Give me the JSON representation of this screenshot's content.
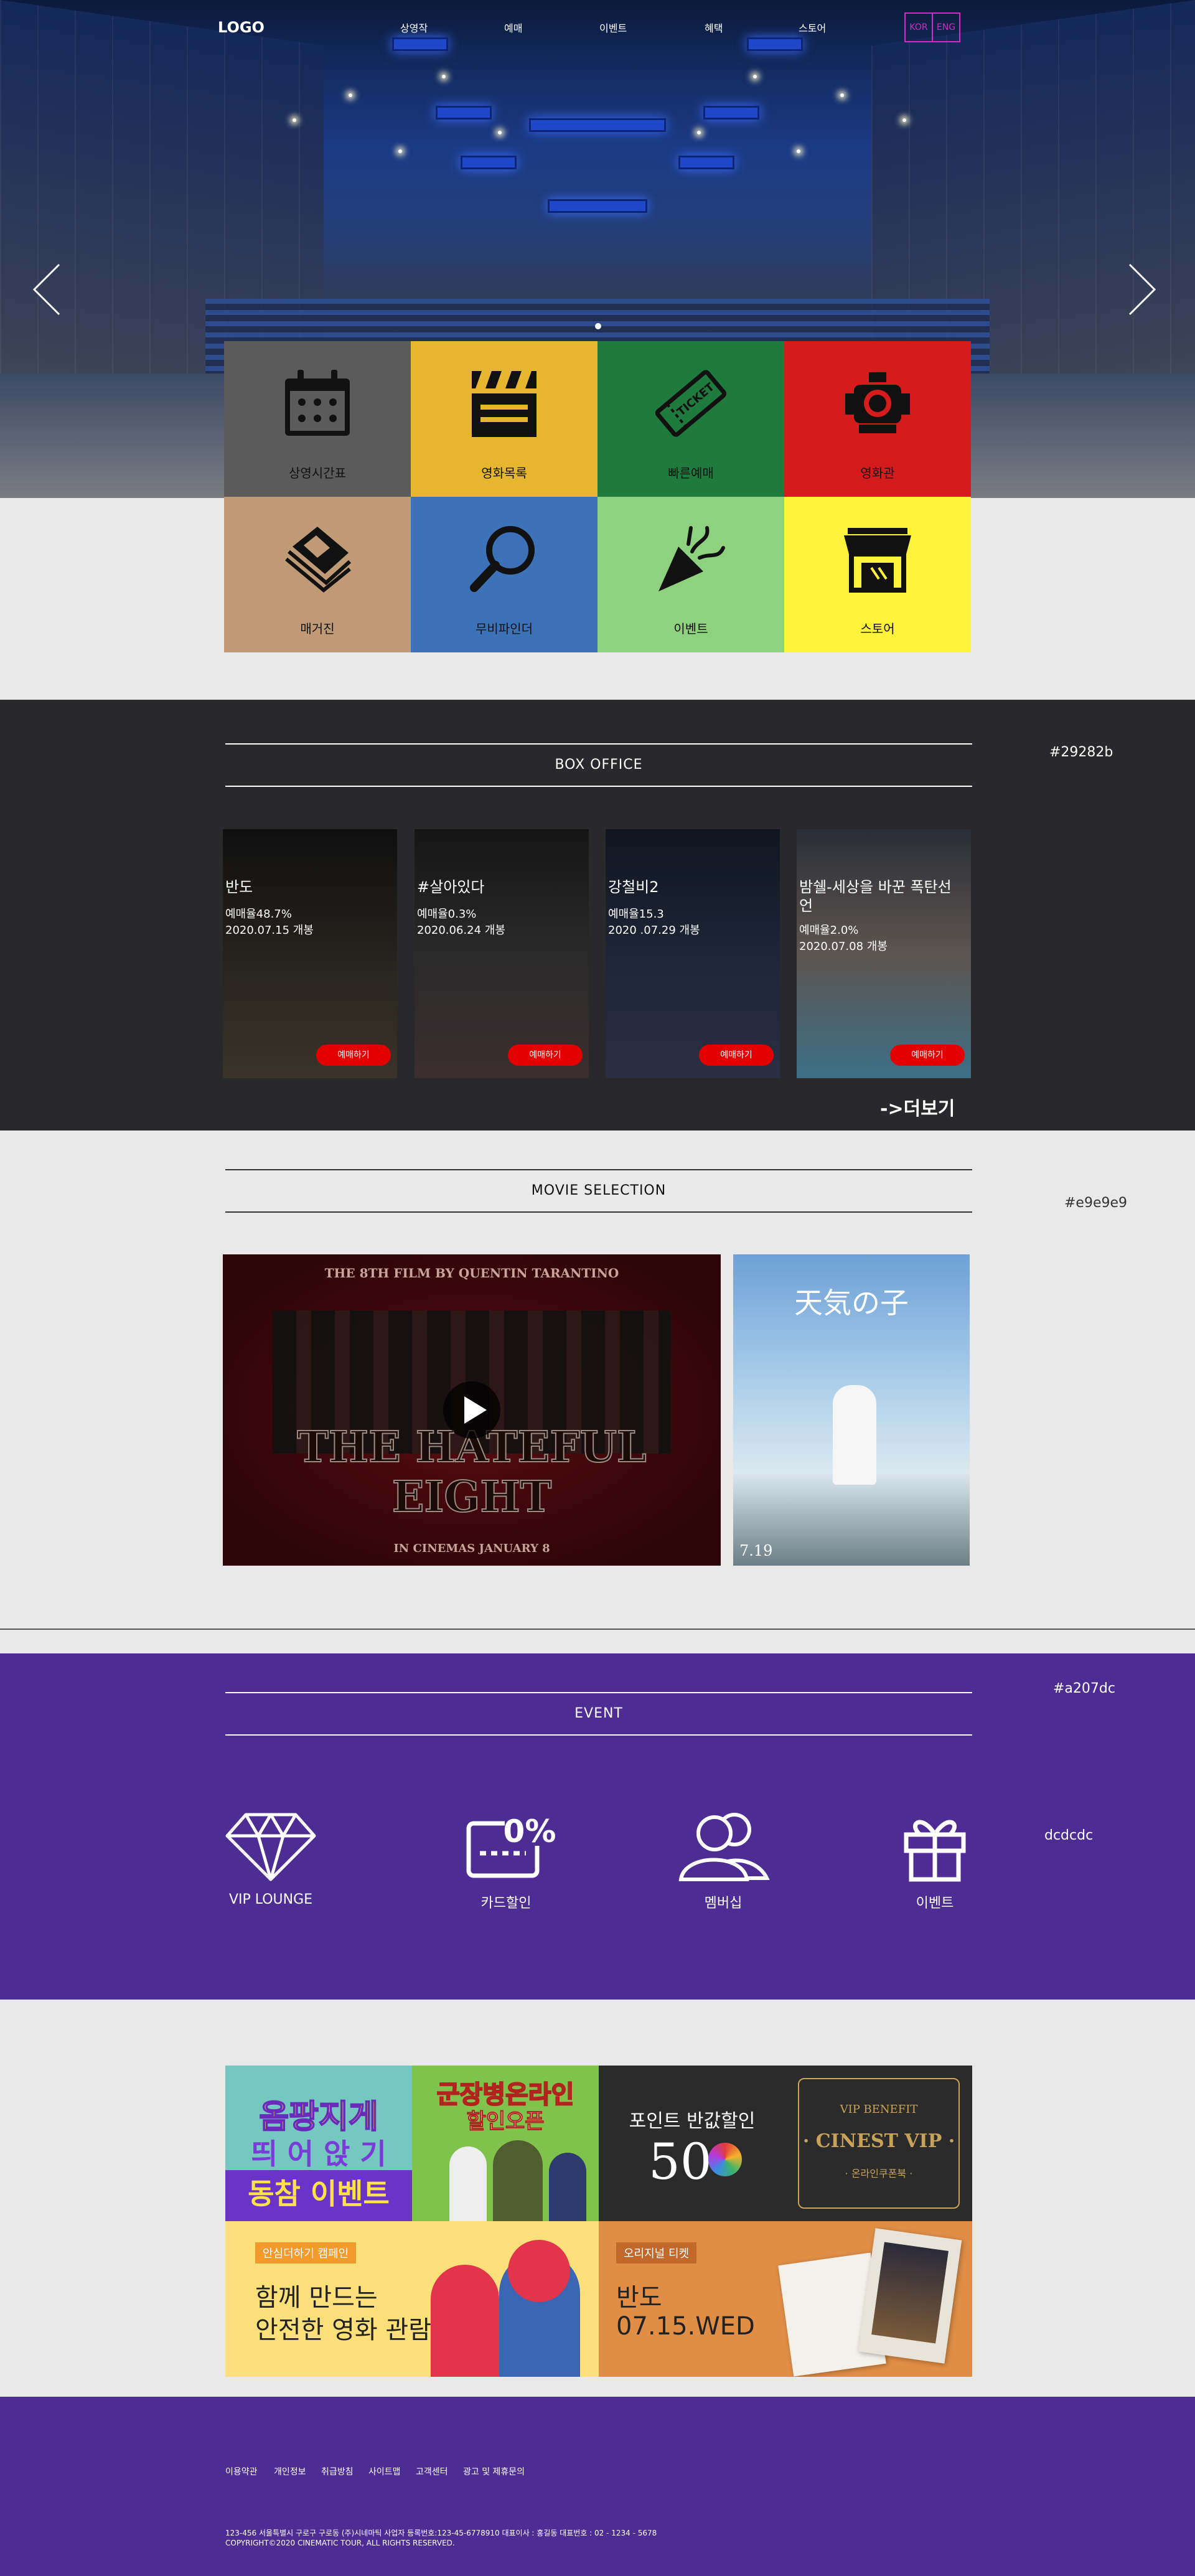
{
  "header": {
    "logo": "LOGO",
    "nav": [
      "상영작",
      "예매",
      "이벤트",
      "혜택",
      "스토어"
    ],
    "lang": [
      "KOR",
      "ENG"
    ]
  },
  "quick_menu": [
    {
      "label": "상영시간표",
      "icon": "calendar-icon",
      "color": "#5b5b5b"
    },
    {
      "label": "영화목록",
      "icon": "clapperboard-icon",
      "color": "#e7b62f"
    },
    {
      "label": "빠른예매",
      "icon": "ticket-icon",
      "color": "#1f7a3e"
    },
    {
      "label": "영화관",
      "icon": "projector-icon",
      "color": "#d41c1c"
    },
    {
      "label": "매거진",
      "icon": "magazine-icon",
      "color": "#bf9a75"
    },
    {
      "label": "무비파인더",
      "icon": "magnifier-icon",
      "color": "#3b72b8"
    },
    {
      "label": "이벤트",
      "icon": "party-popper-icon",
      "color": "#8ed17e"
    },
    {
      "label": "스토어",
      "icon": "store-icon",
      "color": "#fef33a"
    }
  ],
  "box_office": {
    "title": "BOX OFFICE",
    "color_note": "#29282b",
    "more": "->더보기",
    "button": "예매하기",
    "movies": [
      {
        "title": "반도",
        "rate": "예매율48.7%",
        "date": "2020.07.15 개봉"
      },
      {
        "title": "#살아있다",
        "rate": "예매율0.3%",
        "date": "2020.06.24 개봉"
      },
      {
        "title": "강철비2",
        "rate": "예매율15.3",
        "date": "2020 .07.29 개봉"
      },
      {
        "title": "밤쉘-세상을 바꾼 폭탄선언",
        "rate": "예매율2.0%",
        "date": "2020.07.08 개봉"
      }
    ]
  },
  "movie_selection": {
    "title": "MOVIE SELECTION",
    "color_note": "#e9e9e9",
    "feature": {
      "top": "THE 8TH FILM BY QUENTIN TARANTINO",
      "title": "THE HATEFUL EIGHT",
      "bottom": "IN CINEMAS JANUARY 8"
    },
    "side": {
      "title": "天気の子",
      "date": "7.19"
    }
  },
  "event": {
    "title": "EVENT",
    "color_note": "#a207dc",
    "side_note": "dcdcdc",
    "items": [
      {
        "label": "VIP LOUNGE",
        "icon": "diamond-icon"
      },
      {
        "label": "카드할인",
        "icon": "card-discount-icon"
      },
      {
        "label": "멤버십",
        "icon": "members-icon"
      },
      {
        "label": "이벤트",
        "icon": "gift-icon"
      }
    ]
  },
  "banners": {
    "b1": [
      "옴팡지게",
      "띄 어 앉 기",
      "동참 이벤트"
    ],
    "b2": [
      "군장병온라인",
      "할인오픈"
    ],
    "b3": {
      "title": "포인트 반값할인",
      "big": "50"
    },
    "b4": {
      "top": "VIP BENEFIT",
      "title": "· CINEST VIP ·",
      "sub": "· 온라인쿠폰북 ·"
    },
    "b5": {
      "tag": "안심더하기 캠페인",
      "l1": "함께 만드는",
      "l2": "안전한 영화 관람"
    },
    "b6": {
      "tag": "오리지널 티켓",
      "l1": "반도",
      "l2": "07.15.WED"
    }
  },
  "footer": {
    "links": [
      "이용약관",
      "개인정보",
      "취급방침",
      "사이트맵",
      "고객센터",
      "광고 및 제휴문의"
    ],
    "address": "123-456 서울특별시 구로구 구로동 (주)시네마틱 사업자 등록번호:123-45-6778910 대표이사 : 홍길동 대표번호 : 02 - 1234 - 5678",
    "copyright": "COPYRIGHT©2020 CINEMATIC TOUR, ALL RIGHTS RESERVED."
  },
  "colors": {
    "dark": "#29282b",
    "purple": "#4d2c93",
    "red": "#e30000"
  }
}
